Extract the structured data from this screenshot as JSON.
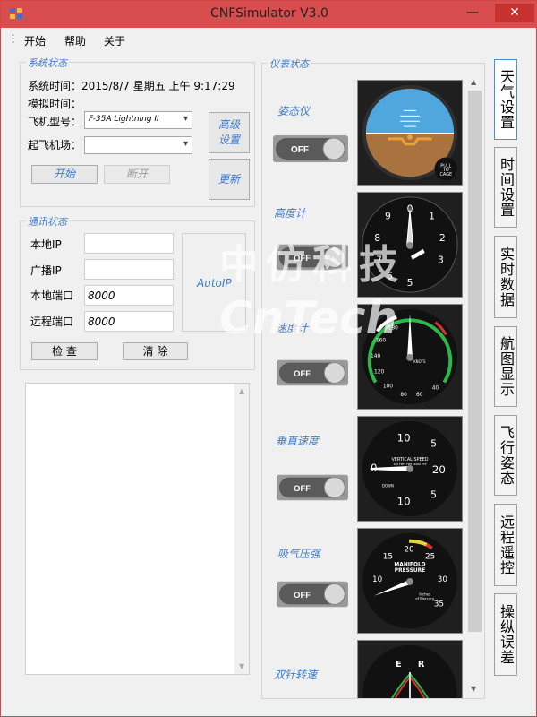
{
  "window": {
    "title": "CNFSimulator V3.0",
    "minimize": "—",
    "close": "✕"
  },
  "menu": [
    "开始",
    "帮助",
    "关于"
  ],
  "system": {
    "legend": "系统状态",
    "sys_time": "系统时间：2015/8/7 星期五 上午 9:17:29",
    "sim_time_label": "模拟时间：",
    "aircraft_label": "飞机型号：",
    "aircraft_value": "F-35A Lightning II",
    "airport_label": "起飞机场：",
    "airport_value": "",
    "advanced_btn": "高级设置",
    "start_btn": "开始",
    "disconnect_btn": "断开",
    "update_btn": "更新"
  },
  "comm": {
    "legend": "通讯状态",
    "local_ip_label": "本地IP",
    "broadcast_ip_label": "广播IP",
    "local_port_label": "本地端口",
    "remote_port_label": "远程端口",
    "local_ip": "",
    "broadcast_ip": "",
    "local_port": "8000",
    "remote_port": "8000",
    "autoip": "AutoIP",
    "check_btn": "检 查",
    "clear_btn": "清 除"
  },
  "instruments": {
    "legend": "仪表状态",
    "items": [
      {
        "label": "姿态仪",
        "toggle": "OFF"
      },
      {
        "label": "高度计",
        "toggle": "OFF"
      },
      {
        "label": "速度计",
        "toggle": "OFF"
      },
      {
        "label": "垂直速度",
        "toggle": "OFF"
      },
      {
        "label": "吸气压强",
        "toggle": "OFF"
      },
      {
        "label": "双针转速"
      }
    ]
  },
  "gauge_text": {
    "pull": "PULL",
    "to": "TO",
    "cage": "CAGE",
    "vs_title": "VERTICAL SPEED",
    "vs_sub": "100 FPPT FPM x1000 YTP",
    "vs_down": "DOWN",
    "mp_title1": "MANIFOLD",
    "mp_title2": "PRESSURE",
    "mp_unit1": "Inches",
    "mp_unit2": "of Mercury",
    "knots": "KNOTS",
    "rpm_e": "E",
    "rpm_r": "R",
    "vs_ticks": [
      "10",
      "5",
      "0",
      "20",
      "5",
      "10"
    ],
    "mp_ticks": [
      "15",
      "20",
      "25",
      "10",
      "30",
      "35"
    ],
    "alt_ticks": [
      "0",
      "1",
      "2",
      "3",
      "5",
      "6",
      "7",
      "8",
      "9"
    ],
    "asi_ticks": [
      "180",
      "160",
      "140",
      "120",
      "100",
      "80",
      "60",
      "40"
    ]
  },
  "tabs": [
    "天气设置",
    "时间设置",
    "实时数据",
    "航图显示",
    "飞行姿态",
    "远程遥控",
    "操纵误差"
  ],
  "watermark": {
    "cn": "中仿科技",
    "en": "CnTech"
  },
  "colors": {
    "title_bar": "#d84e4e",
    "close": "#c7312f",
    "accent": "#3c7bc8"
  }
}
